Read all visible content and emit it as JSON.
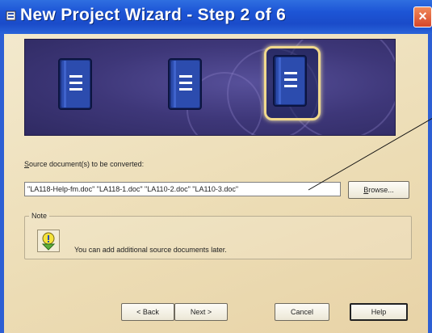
{
  "window": {
    "title": "New Project Wizard - Step 2 of 6",
    "close_label": "×"
  },
  "banner": {
    "books": [
      "book-1",
      "book-2",
      "book-3-selected"
    ]
  },
  "source": {
    "label_prefix_underlined": "S",
    "label_rest": "ource document(s) to be converted:",
    "value": "\"LA118-Help-fm.doc\" \"LA118-1.doc\" \"LA110-2.doc\" \"LA110-3.doc\"",
    "browse_label_underlined": "B",
    "browse_label_rest": "rowse..."
  },
  "note": {
    "label": "Note",
    "text": "You can add additional source documents later.",
    "icon": "lightbulb-info-icon"
  },
  "buttons": {
    "back": "< Back",
    "next": "Next >",
    "cancel": "Cancel",
    "help": "Help"
  },
  "colors": {
    "titlebar": "#1d55d6",
    "client": "#f0e5c8",
    "banner": "#3e3779",
    "highlight": "#f1d98c",
    "orange_frame": "#e38b2f"
  }
}
